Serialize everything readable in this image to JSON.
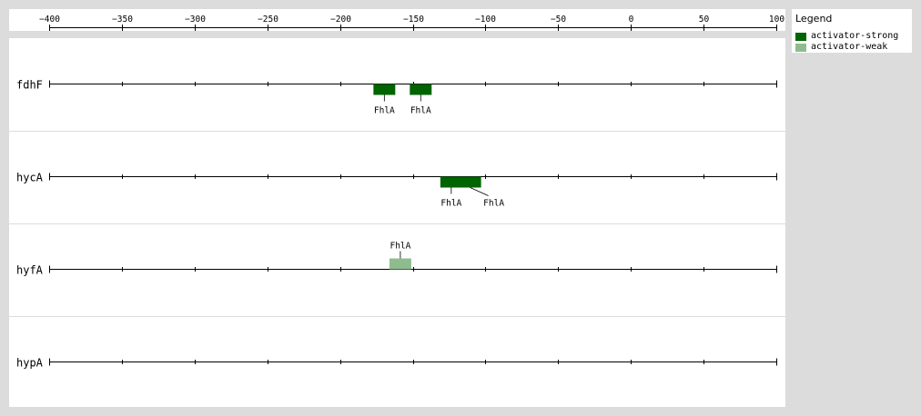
{
  "axis": {
    "min": -400,
    "max": 100,
    "tick_values": [
      -400,
      -350,
      -300,
      -250,
      -200,
      -150,
      -100,
      -50,
      0,
      50,
      100
    ],
    "tick_labels": [
      "−400",
      "−350",
      "−300",
      "−250",
      "−200",
      "−150",
      "−100",
      "−50",
      "0",
      "50",
      "100"
    ]
  },
  "legend": {
    "title": "Legend",
    "items": [
      {
        "label": "activator-strong",
        "color": "#006400"
      },
      {
        "label": "activator-weak",
        "color": "#8fbc8f"
      }
    ]
  },
  "tracks": [
    {
      "gene": "fdhF",
      "sites": [
        {
          "label": "FhlA",
          "start": -177,
          "end": -162,
          "type": "activator-strong",
          "label_side": "below"
        },
        {
          "label": "FhlA",
          "start": -152,
          "end": -137,
          "type": "activator-strong",
          "label_side": "below"
        }
      ]
    },
    {
      "gene": "hycA",
      "sites": [
        {
          "label": "FhlA",
          "start": -131,
          "end": -116,
          "type": "activator-strong",
          "label_side": "below"
        },
        {
          "label": "FhlA",
          "start": -118,
          "end": -103,
          "type": "activator-strong",
          "label_side": "below"
        }
      ]
    },
    {
      "gene": "hyfA",
      "sites": [
        {
          "label": "FhlA",
          "start": -166,
          "end": -151,
          "type": "activator-weak",
          "label_side": "above"
        }
      ]
    },
    {
      "gene": "hypA",
      "sites": []
    }
  ]
}
